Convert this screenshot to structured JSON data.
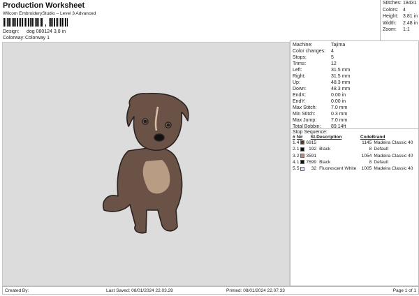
{
  "header": {
    "title": "Production Worksheet",
    "subtitle": "Wilcom EmbroideryStudio – Level 3 Advanced",
    "design_label": "Design:",
    "design_value": "dog 080124 3,8 in",
    "colorway_label": "Colorway:",
    "colorway_value": "Colorway 1"
  },
  "summary": [
    {
      "k": "Stitches:",
      "v": "18431"
    },
    {
      "k": "Colors:",
      "v": "4"
    },
    {
      "k": "Height:",
      "v": "3.81 in"
    },
    {
      "k": "Width:",
      "v": "2.48 in"
    },
    {
      "k": "Zoom:",
      "v": "1:1"
    }
  ],
  "stats": [
    {
      "k": "Machine:",
      "v": "Tajima"
    },
    {
      "k": "Color changes:",
      "v": "4"
    },
    {
      "k": "Stops:",
      "v": "5"
    },
    {
      "k": "Trims:",
      "v": "12"
    },
    {
      "k": "Left:",
      "v": "31.5 mm"
    },
    {
      "k": "Right:",
      "v": "31.5 mm"
    },
    {
      "k": "Up:",
      "v": "48.3 mm"
    },
    {
      "k": "Down:",
      "v": "48.3 mm"
    },
    {
      "k": "EndX:",
      "v": "0.00 in"
    },
    {
      "k": "EndY:",
      "v": "0.00 in"
    },
    {
      "k": "Max Stitch:",
      "v": "7.0 mm"
    },
    {
      "k": "Min Stitch:",
      "v": "0.3 mm"
    },
    {
      "k": "Max Jump:",
      "v": "7.0 mm"
    },
    {
      "k": "Total Bobbin:",
      "v": "89.14ft"
    }
  ],
  "stop_sequence": {
    "title": "Stop Sequence:",
    "headers": [
      "#",
      "N#",
      "St.",
      "Description",
      "Code",
      "Brand"
    ],
    "rows": [
      {
        "num": "1.",
        "n": "4",
        "color": "#5b3b30",
        "st": "6915",
        "desc": "",
        "code": "1145",
        "brand": "Madeira Classic 40"
      },
      {
        "num": "2.",
        "n": "1",
        "color": "#111111",
        "st": "192",
        "desc": "Black",
        "code": "8",
        "brand": "Default"
      },
      {
        "num": "3.",
        "n": "2",
        "color": "#b58a7c",
        "st": "3591",
        "desc": "",
        "code": "1054",
        "brand": "Madeira Classic 40"
      },
      {
        "num": "4.",
        "n": "1",
        "color": "#111111",
        "st": "7699",
        "desc": "Black",
        "code": "8",
        "brand": "Default"
      },
      {
        "num": "5.",
        "n": "5",
        "color": "#dde2f2",
        "st": "32",
        "desc": "Fluorescent White",
        "code": "1005",
        "brand": "Madeira Classic 40"
      }
    ]
  },
  "footer": {
    "created": "Created By:",
    "saved": "Last Saved: 08/01/2024 22.03.28",
    "printed": "Printed: 08/01/2024 22.07.33",
    "page": "Page 1 of 1"
  }
}
